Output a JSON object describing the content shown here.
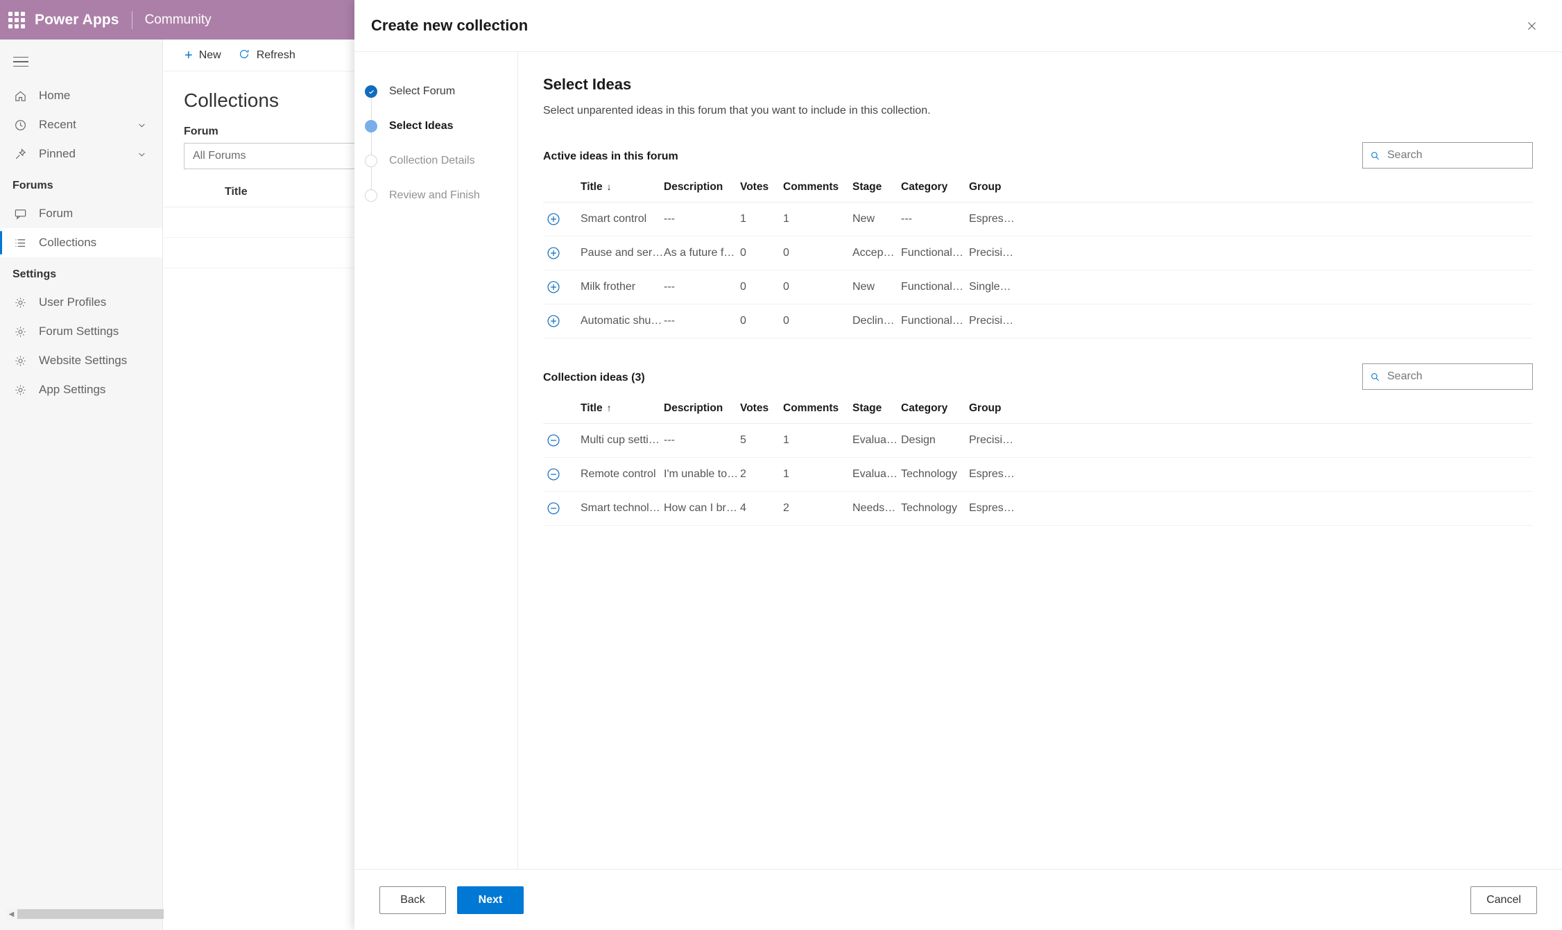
{
  "topbar": {
    "waffle_icon": "waffle-grid-icon",
    "brand": "Power Apps",
    "app_name": "Community",
    "bg_color": "#ac7fa8"
  },
  "sidebar": {
    "hamburger_icon": "hamburger-menu-icon",
    "items": [
      {
        "label": "Home",
        "icon": "home-icon",
        "expandable": false
      },
      {
        "label": "Recent",
        "icon": "clock-icon",
        "expandable": true
      },
      {
        "label": "Pinned",
        "icon": "pin-icon",
        "expandable": true
      }
    ],
    "forums_group": "Forums",
    "forums_items": [
      {
        "label": "Forum",
        "icon": "forum-icon",
        "active": false
      },
      {
        "label": "Collections",
        "icon": "list-icon",
        "active": true
      }
    ],
    "settings_group": "Settings",
    "settings_items": [
      {
        "label": "User Profiles",
        "icon": "gear-icon"
      },
      {
        "label": "Forum Settings",
        "icon": "gear-icon"
      },
      {
        "label": "Website Settings",
        "icon": "gear-icon"
      },
      {
        "label": "App Settings",
        "icon": "gear-icon"
      }
    ]
  },
  "background_page": {
    "commands": [
      {
        "label": "New",
        "icon": "plus-icon"
      },
      {
        "label": "Refresh",
        "icon": "refresh-icon"
      }
    ],
    "title": "Collections",
    "filter_label": "Forum",
    "filter_value": "All Forums",
    "table_header_title": "Title"
  },
  "dialog": {
    "title": "Create new collection",
    "close_icon": "close-icon",
    "steps": [
      {
        "label": "Select Forum",
        "state": "done"
      },
      {
        "label": "Select Ideas",
        "state": "current"
      },
      {
        "label": "Collection Details",
        "state": "todo"
      },
      {
        "label": "Review and Finish",
        "state": "todo"
      }
    ],
    "panel": {
      "title": "Select Ideas",
      "subtitle": "Select unparented ideas in this forum that you want to include in this collection.",
      "active_section": {
        "label": "Active ideas in this forum",
        "search_placeholder": "Search",
        "search_icon": "search-icon",
        "columns": [
          "",
          "Title",
          "Description",
          "Votes",
          "Comments",
          "Stage",
          "Category",
          "Group"
        ],
        "sort_column": "Title",
        "sort_direction": "↓",
        "row_action_icon": "circle-plus-icon",
        "rows": [
          {
            "title": "Smart control",
            "description": "---",
            "votes": "1",
            "comments": "1",
            "stage": "New",
            "category": "---",
            "group": "Espres…"
          },
          {
            "title": "Pause and serve",
            "description": "As a future fea…",
            "votes": "0",
            "comments": "0",
            "stage": "Accep…",
            "category": "Functional…",
            "group": "Precisi…"
          },
          {
            "title": "Milk frother",
            "description": "---",
            "votes": "0",
            "comments": "0",
            "stage": "New",
            "category": "Functional…",
            "group": "Single…"
          },
          {
            "title": "Automatic shu…",
            "description": "---",
            "votes": "0",
            "comments": "0",
            "stage": "Declin…",
            "category": "Functional…",
            "group": "Precisi…"
          }
        ]
      },
      "collection_section": {
        "label": "Collection ideas (3)",
        "search_placeholder": "Search",
        "search_icon": "search-icon",
        "columns": [
          "",
          "Title",
          "Description",
          "Votes",
          "Comments",
          "Stage",
          "Category",
          "Group"
        ],
        "sort_column": "Title",
        "sort_direction": "↑",
        "row_action_icon": "circle-minus-icon",
        "rows": [
          {
            "title": "Multi cup setti…",
            "description": "---",
            "votes": "5",
            "comments": "1",
            "stage": "Evalua…",
            "category": "Design",
            "group": "Precisi…"
          },
          {
            "title": "Remote control",
            "description": "I'm unable to …",
            "votes": "2",
            "comments": "1",
            "stage": "Evalua…",
            "category": "Technology",
            "group": "Espres…"
          },
          {
            "title": "Smart technol…",
            "description": "How can I bre…",
            "votes": "4",
            "comments": "2",
            "stage": "Needs…",
            "category": "Technology",
            "group": "Espres…"
          }
        ]
      }
    },
    "footer": {
      "back_label": "Back",
      "next_label": "Next",
      "cancel_label": "Cancel"
    }
  },
  "colors": {
    "brand": "#ac7fa8",
    "accent": "#0078d4",
    "step_done": "#0f6cbd",
    "step_current": "#7aaeea"
  }
}
